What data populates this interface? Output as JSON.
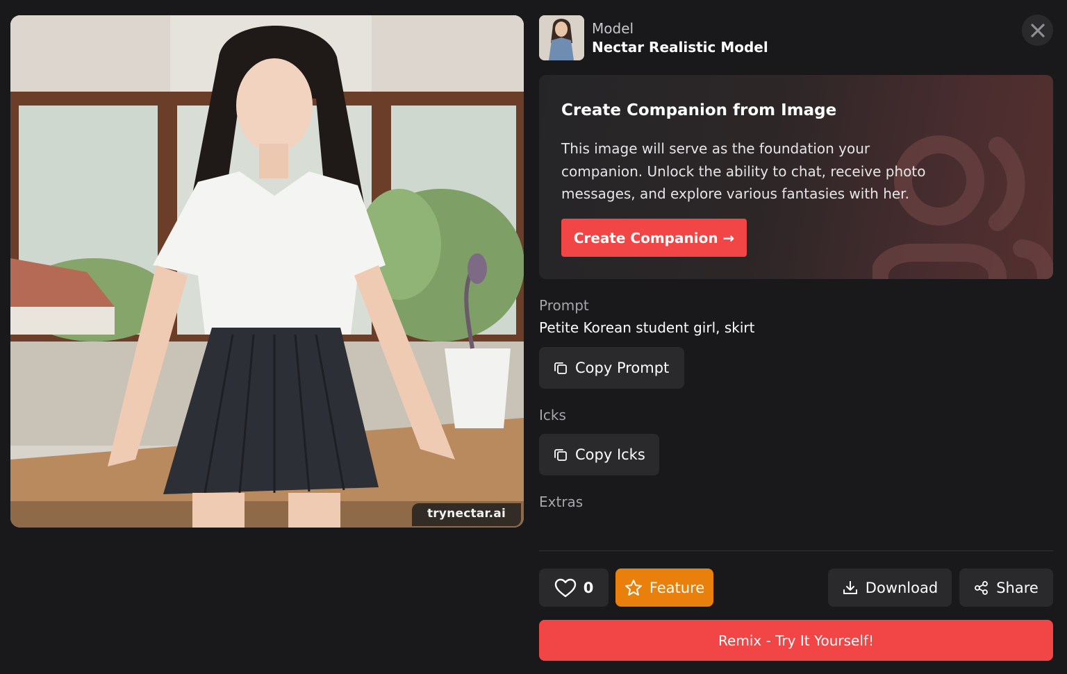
{
  "image": {
    "watermark": "trynectar.ai"
  },
  "header": {
    "model_caption": "Model",
    "model_name": "Nectar Realistic Model",
    "close_icon": "close-icon"
  },
  "companion_card": {
    "title": "Create Companion from Image",
    "description": "This image will serve as the foundation your companion. Unlock the ability to chat, receive photo messages, and explore various fantasies with her.",
    "button_label": "Create Companion →"
  },
  "prompt": {
    "label": "Prompt",
    "text": "Petite Korean student girl, skirt",
    "copy_label": "Copy Prompt"
  },
  "icks": {
    "label": "Icks",
    "copy_label": "Copy Icks"
  },
  "extras": {
    "label": "Extras"
  },
  "actions": {
    "like_count": "0",
    "feature_label": "Feature",
    "download_label": "Download",
    "share_label": "Share",
    "remix_label": "Remix - Try It Yourself!"
  },
  "colors": {
    "background": "#19191b",
    "accent_red": "#f24646",
    "feature_orange": "#e8800b",
    "button_dark": "#2a2a2d"
  }
}
